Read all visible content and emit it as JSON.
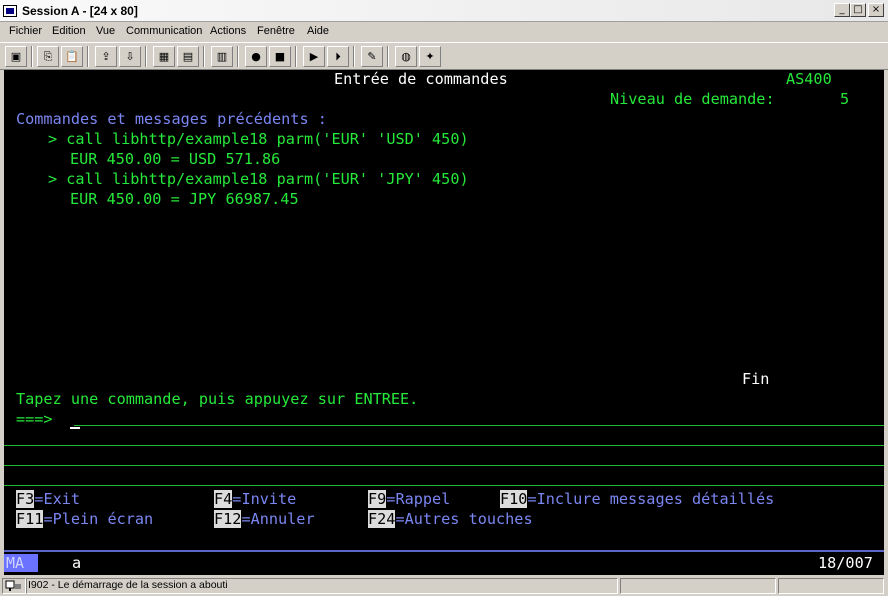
{
  "window": {
    "title": "Session A - [24 x 80]",
    "buttons": {
      "minimize": "_",
      "maximize": "□",
      "close": "×"
    }
  },
  "menu": [
    "Fichier",
    "Edition",
    "Vue",
    "Communication",
    "Actions",
    "Fenêtre",
    "Aide"
  ],
  "toolbar_icons": [
    "print-screen-icon",
    "copy-icon",
    "paste-icon",
    "send-icon",
    "receive-icon",
    "display-icon",
    "keypad-icon",
    "macro-icon",
    "record-icon",
    "play-icon",
    "play-macro-icon",
    "stop-icon",
    "clipboard-icon",
    "globe-icon",
    "help-icon"
  ],
  "terminal": {
    "title": "Entrée de commandes",
    "system": "AS400",
    "level_label": "Niveau de demande:",
    "level_value": "5",
    "history_header": "Commandes et messages précédents :",
    "history": [
      {
        "command": "> call libhttp/example18 parm('EUR' 'USD' 450)",
        "result": "EUR 450.00 = USD 571.86"
      },
      {
        "command": "> call libhttp/example18 parm('EUR' 'JPY' 450)",
        "result": "EUR 450.00 = JPY 66987.45"
      }
    ],
    "end_marker": "Fin",
    "prompt_text": "Tapez une commande, puis appuyez sur ENTREE.",
    "prompt_arrow": "===>",
    "fkeys_row1": [
      {
        "key": "F3",
        "label": "=Exit"
      },
      {
        "key": "F4",
        "label": "=Invite"
      },
      {
        "key": "F9",
        "label": "=Rappel"
      },
      {
        "key": "F10",
        "label": "=Inclure messages détaillés"
      }
    ],
    "fkeys_row2": [
      {
        "key": "F11",
        "label": "=Plein écran"
      },
      {
        "key": "F12",
        "label": "=Annuler"
      },
      {
        "key": "F24",
        "label": "=Autres touches"
      }
    ],
    "oia": {
      "mode": "MA",
      "input": "a",
      "position": "18/007"
    }
  },
  "statusbar": {
    "message": "I902 - Le démarrage de la session a abouti"
  }
}
